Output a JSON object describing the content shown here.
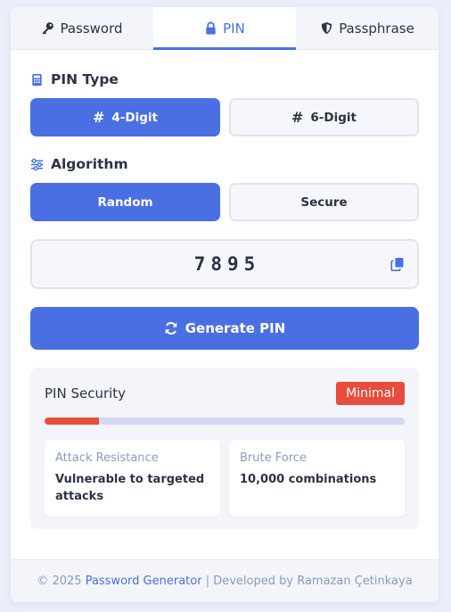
{
  "tabs": [
    {
      "label": "Password",
      "icon": "key-icon"
    },
    {
      "label": "PIN",
      "icon": "lock-icon"
    },
    {
      "label": "Passphrase",
      "icon": "shield-icon"
    }
  ],
  "active_tab": "PIN",
  "pin_type": {
    "title": "PIN Type",
    "options": [
      {
        "label": "4-Digit",
        "selected": true
      },
      {
        "label": "6-Digit",
        "selected": false
      }
    ]
  },
  "algorithm": {
    "title": "Algorithm",
    "options": [
      {
        "label": "Random",
        "selected": true
      },
      {
        "label": "Secure",
        "selected": false
      }
    ]
  },
  "pin_display": {
    "value": "7895"
  },
  "generate_button": {
    "label": "Generate PIN"
  },
  "security": {
    "title": "PIN Security",
    "badge": "Minimal",
    "strength_fraction": 0.15,
    "stats": [
      {
        "label": "Attack Resistance",
        "value": "Vulnerable to targeted attacks"
      },
      {
        "label": "Brute Force",
        "value": "10,000 combinations"
      }
    ]
  },
  "footer": {
    "prefix": "© 2025",
    "link": "Password Generator",
    "separator": "|",
    "suffix": "Developed by Ramazan Çetinkaya"
  },
  "colors": {
    "accent": "#4a6fe3",
    "danger": "#e74c3c",
    "text": "#2c3344",
    "muted": "#8a9bbf"
  }
}
